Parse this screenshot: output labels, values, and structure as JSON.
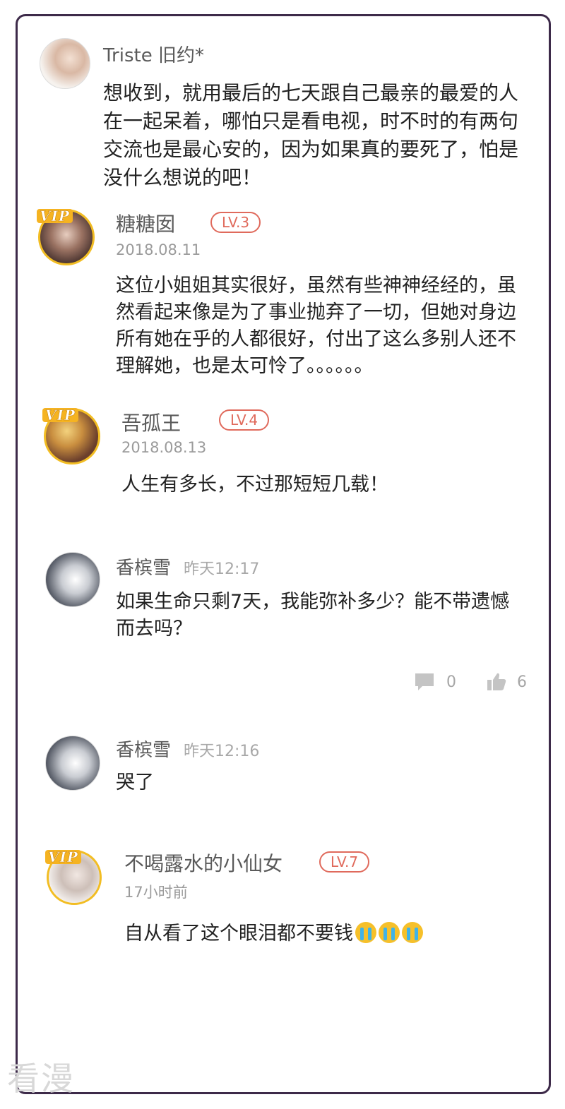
{
  "comments": [
    {
      "name": "Triste 旧约*",
      "text": "想收到，就用最后的七天跟自己最亲的最爱的人在一起呆着，哪怕只是看电视，时不时的有两句交流也是最心安的，因为如果真的要死了，怕是没什么想说的吧！"
    },
    {
      "name": "糖糖囡",
      "level": "LV.3",
      "date": "2018.08.11",
      "vip": "VIP",
      "text": "这位小姐姐其实很好，虽然有些神神经经的，虽然看起来像是为了事业抛弃了一切，但她对身边所有她在乎的人都很好，付出了这么多别人还不理解她，也是太可怜了。。。。。。"
    },
    {
      "name": "吾孤王",
      "level": "LV.4",
      "date": "2018.08.13",
      "vip": "VIP",
      "text": "人生有多长，不过那短短几载！"
    },
    {
      "name": "香槟雪",
      "date": "昨天12:17",
      "text": "如果生命只剩7天，我能弥补多少？能不带遗憾而去吗？",
      "reply_count": "0",
      "like_count": "6"
    },
    {
      "name": "香槟雪",
      "date": "昨天12:16",
      "text": "哭了"
    },
    {
      "name": "不喝露水的小仙女",
      "level": "LV.7",
      "date": "17小时前",
      "vip": "VIP",
      "text": "自从看了这个眼泪都不要钱"
    }
  ],
  "emoji_count": 3,
  "watermark": "看漫"
}
